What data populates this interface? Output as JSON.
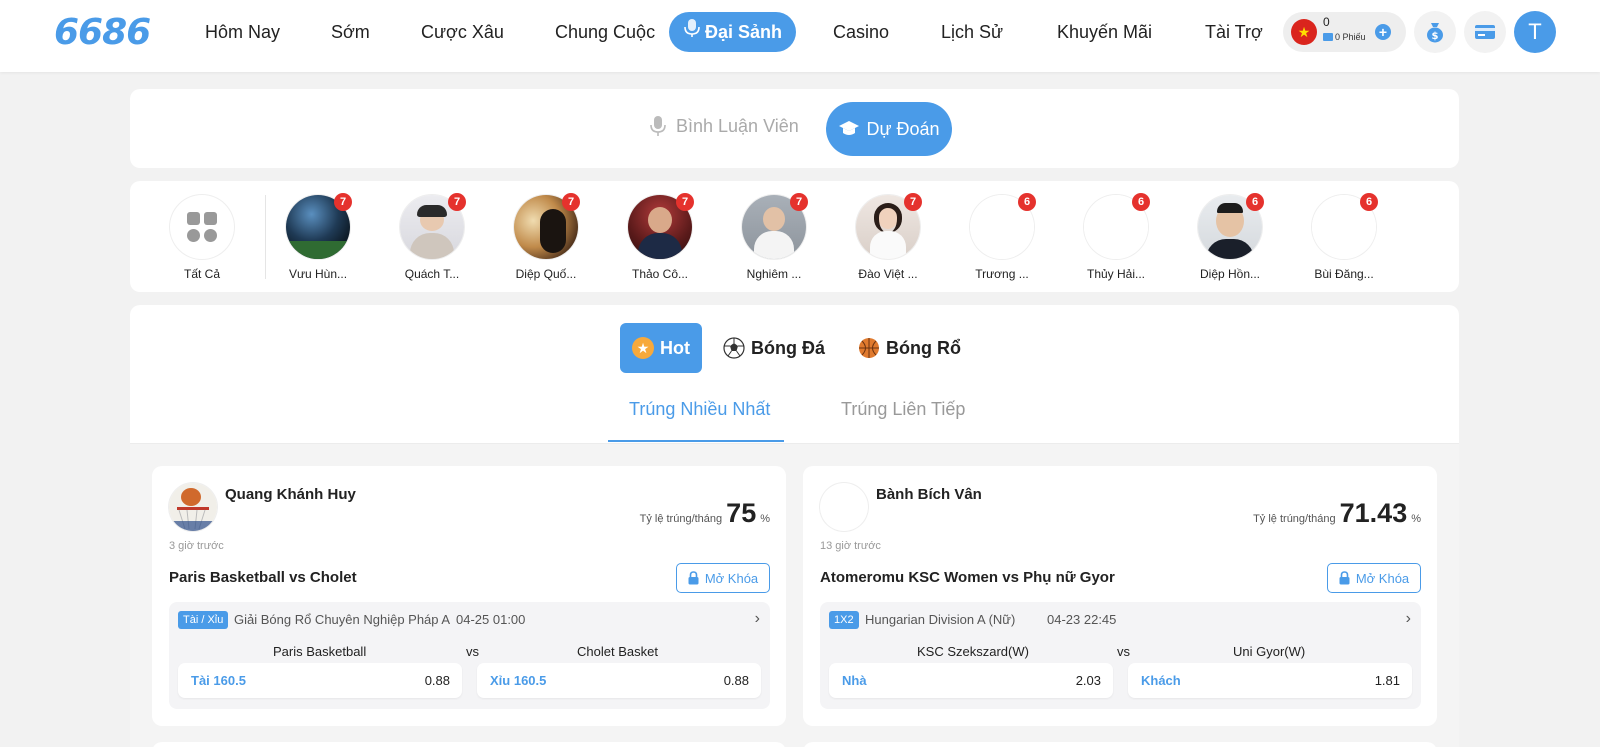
{
  "header": {
    "logo": "6686",
    "nav": [
      "Hôm Nay",
      "Sớm",
      "Cược Xâu",
      "Chung Cuộc",
      "Đại Sảnh",
      "Casino",
      "Lịch Sử",
      "Khuyến Mãi",
      "Tài Trợ"
    ],
    "active_nav": "Đại Sảnh",
    "wallet": {
      "balance": "0",
      "tickets": "0 Phiếu"
    },
    "user_initial": "T"
  },
  "mode_tabs": {
    "commentator": "Bình Luận Viên",
    "predict": "Dự Đoán"
  },
  "experts": {
    "all_label": "Tất Cả",
    "items": [
      {
        "name": "Vưu Hùn...",
        "count": "7"
      },
      {
        "name": "Quách T...",
        "count": "7"
      },
      {
        "name": "Diệp Quố...",
        "count": "7"
      },
      {
        "name": "Thảo Cô...",
        "count": "7"
      },
      {
        "name": "Nghiêm ...",
        "count": "7"
      },
      {
        "name": "Đào Việt ...",
        "count": "7"
      },
      {
        "name": "Trương ...",
        "count": "6"
      },
      {
        "name": "Thủy Hải...",
        "count": "6"
      },
      {
        "name": "Diệp Hồn...",
        "count": "6"
      },
      {
        "name": "Bùi Đăng...",
        "count": "6"
      }
    ]
  },
  "sport_tabs": [
    "Hot",
    "Bóng Đá",
    "Bóng Rổ"
  ],
  "sub_tabs": [
    "Trúng Nhiều Nhất",
    "Trúng Liên Tiếp"
  ],
  "cards": [
    {
      "user": "Quang Khánh Huy",
      "ago": "3 giờ trước",
      "rate_label": "Tỷ lệ trúng/tháng",
      "rate": "75",
      "pct": "%",
      "match": "Paris Basketball vs Cholet",
      "unlock": "Mở Khóa",
      "market": "Tài / Xỉu",
      "league": "Giải Bóng Rổ Chuyên Nghiệp Pháp A",
      "time": "04-25 01:00",
      "home": "Paris Basketball",
      "vs": "vs",
      "away": "Cholet Basket",
      "pick1_label": "Tài 160.5",
      "pick1_odds": "0.88",
      "pick2_label": "Xỉu 160.5",
      "pick2_odds": "0.88"
    },
    {
      "user": "Bành Bích Vân",
      "ago": "13 giờ trước",
      "rate_label": "Tỷ lệ trúng/tháng",
      "rate": "71.43",
      "pct": "%",
      "match": "Atomeromu KSC Women vs Phụ nữ Gyor",
      "unlock": "Mở Khóa",
      "market": "1X2",
      "league": "Hungarian Division A (Nữ)",
      "time": "04-23 22:45",
      "home": "KSC Szekszard(W)",
      "vs": "vs",
      "away": "Uni Gyor(W)",
      "pick1_label": "Nhà",
      "pick1_odds": "2.03",
      "pick2_label": "Khách",
      "pick2_odds": "1.81"
    }
  ],
  "colors": {
    "accent": "#4a9be8",
    "badge": "#e5322d",
    "background": "#f2f2f2"
  }
}
